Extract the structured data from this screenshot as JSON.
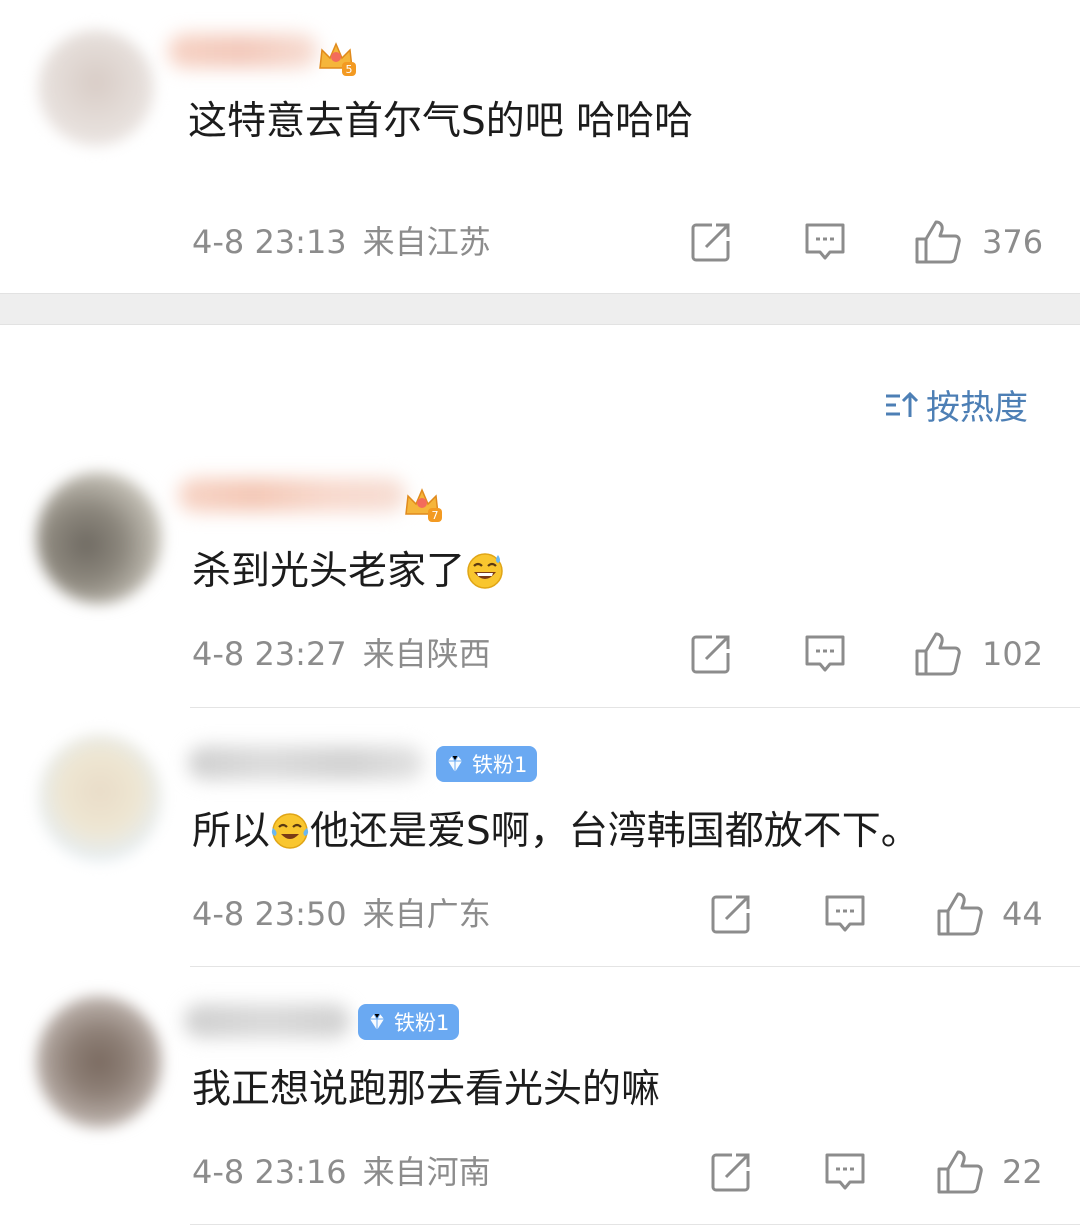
{
  "sort": {
    "label": "按热度",
    "icon": "sort-icon"
  },
  "comments": [
    {
      "text": "这特意去首尔气S的吧 哈哈哈",
      "time": "4-8 23:13",
      "location": "来自江苏",
      "likes": "376",
      "level": "5",
      "badge": "",
      "emoji": ""
    },
    {
      "text_before": "杀到光头老家了",
      "emoji": "grinning-sweat-emoji",
      "time": "4-8 23:27",
      "location": "来自陕西",
      "likes": "102",
      "level": "7",
      "badge": ""
    },
    {
      "text_before": "所以",
      "emoji": "crying-laughing-emoji",
      "text_after": "他还是爱S啊，台湾韩国都放不下。",
      "time": "4-8 23:50",
      "location": "来自广东",
      "likes": "44",
      "badge": "铁粉1"
    },
    {
      "text": "我正想说跑那去看光头的嘛",
      "time": "4-8 23:16",
      "location": "来自河南",
      "likes": "22",
      "badge": "铁粉1"
    }
  ],
  "colors": {
    "meta": "#8c8c8c",
    "accent": "#4d7fb5",
    "badge": "#6aa9f2"
  }
}
